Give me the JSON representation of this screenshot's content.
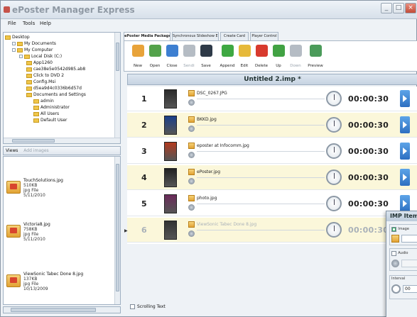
{
  "window": {
    "title": "ePoster Manager Express"
  },
  "menu": [
    "File",
    "Tools",
    "Help"
  ],
  "tree": {
    "items": [
      {
        "label": "Desktop",
        "level": 0
      },
      {
        "label": "My Documents",
        "level": 1
      },
      {
        "label": "My Computer",
        "level": 1
      },
      {
        "label": "Local Disk (C:)",
        "level": 2
      },
      {
        "label": "App1260",
        "level": 3
      },
      {
        "label": "cae38e5e0542d985.ab8",
        "level": 3
      },
      {
        "label": "Click to DVD 2",
        "level": 3
      },
      {
        "label": "Config.Msi",
        "level": 3
      },
      {
        "label": "d5ea9d4c0336b6d57d",
        "level": 3
      },
      {
        "label": "Documents and Settings",
        "level": 3
      },
      {
        "label": "admin",
        "level": 4
      },
      {
        "label": "Administrator",
        "level": 4
      },
      {
        "label": "All Users",
        "level": 4
      },
      {
        "label": "Default User",
        "level": 4
      }
    ]
  },
  "views_bar": {
    "views": "Views",
    "add": "Add images"
  },
  "files": [
    {
      "name": "TouchSolutions.jpg",
      "size": "510KB",
      "type": "jpg File",
      "date": "5/11/2010"
    },
    {
      "name": "Victoria8.jpg",
      "size": "758KB",
      "type": "jpg File",
      "date": "5/11/2010"
    },
    {
      "name": "ViewSonic Tabec Done 8.jpg",
      "size": "137KB",
      "type": "jpg File",
      "date": "10/13/2009"
    }
  ],
  "tabs": [
    {
      "label": "ePoster Media Package IMP"
    },
    {
      "label": "Synchronous Slideshow EBS"
    },
    {
      "label": "Create Card"
    },
    {
      "label": "Player Control"
    }
  ],
  "toolbar": [
    {
      "label": "New",
      "color": "#e8a33a"
    },
    {
      "label": "Open",
      "color": "#53a24b"
    },
    {
      "label": "Close",
      "color": "#3d7fd1"
    },
    {
      "label": "Sendi",
      "color": "#b5bcc4",
      "disabled": true
    },
    {
      "label": "Save",
      "color": "#2e3a48"
    },
    {
      "label": "Append",
      "color": "#3ea842"
    },
    {
      "label": "Edit",
      "color": "#e6b93a"
    },
    {
      "label": "Delete",
      "color": "#d83a2e"
    },
    {
      "label": "Up",
      "color": "#41a243"
    },
    {
      "label": "Down",
      "color": "#b5bcc4",
      "disabled": true
    },
    {
      "label": "Preview",
      "color": "#4b9b5a"
    }
  ],
  "playlist": {
    "title": "Untitled 2.imp *",
    "items": [
      {
        "num": "1",
        "file": "DSC_0267.JPG",
        "time": "00:00:30"
      },
      {
        "num": "2",
        "file": "BKKD.jpg",
        "time": "00:00:30"
      },
      {
        "num": "3",
        "file": "eposter at Infocomm.jpg",
        "time": "00:00:30"
      },
      {
        "num": "4",
        "file": "ePoster.jpg",
        "time": "00:00:30"
      },
      {
        "num": "5",
        "file": "photo.jpg",
        "time": "00:00:30"
      },
      {
        "num": "6",
        "file": "ViewSonic Tabec Done 8.jpg",
        "time": "00:00:30"
      }
    ]
  },
  "scrolling": {
    "label": "Scrolling Text"
  },
  "panel": {
    "title": "IMP Item",
    "image_label": "Image",
    "audio_label": "Audio",
    "interval_label": "Interval",
    "interval_value": "00"
  }
}
